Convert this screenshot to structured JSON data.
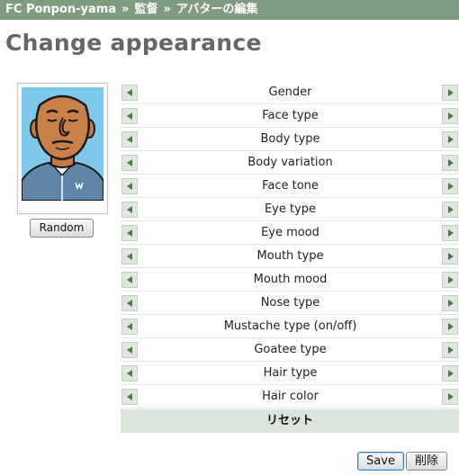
{
  "breadcrumb": {
    "team": "FC Ponpon-yama",
    "separator": "»",
    "manager": "監督",
    "current": "アバターの編集"
  },
  "page": {
    "title": "Change appearance"
  },
  "avatar": {
    "random_label": "Random"
  },
  "options": [
    {
      "label": "Gender"
    },
    {
      "label": "Face type"
    },
    {
      "label": "Body type"
    },
    {
      "label": "Body variation"
    },
    {
      "label": "Face tone"
    },
    {
      "label": "Eye type"
    },
    {
      "label": "Eye mood"
    },
    {
      "label": "Mouth type"
    },
    {
      "label": "Mouth mood"
    },
    {
      "label": "Nose type"
    },
    {
      "label": "Mustache type (on/off)"
    },
    {
      "label": "Goatee type"
    },
    {
      "label": "Hair type"
    },
    {
      "label": "Hair color"
    }
  ],
  "reset_label": "リセット",
  "actions": {
    "save_label": "Save",
    "delete_label": "削除"
  },
  "colors": {
    "header_bg": "#7f9c7f",
    "accent_green": "#4d7a4d",
    "reset_bg": "#dbe4db"
  }
}
